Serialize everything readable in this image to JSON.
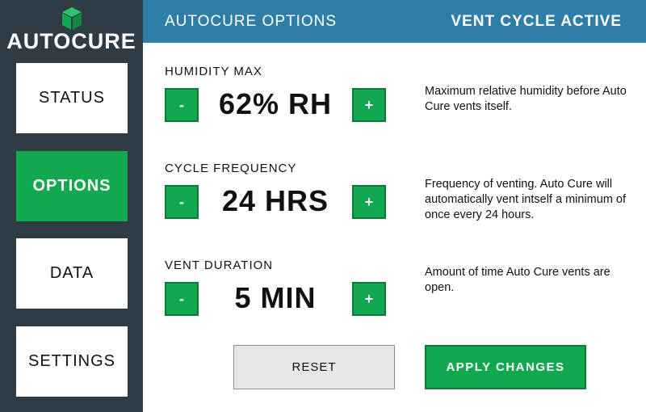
{
  "brand": {
    "logo_text": "AUTOCURE",
    "logo_icon": "cube-icon"
  },
  "nav": {
    "items": [
      {
        "label": "STATUS",
        "active": false
      },
      {
        "label": "OPTIONS",
        "active": true
      },
      {
        "label": "DATA",
        "active": false
      },
      {
        "label": "SETTINGS",
        "active": false
      }
    ]
  },
  "header": {
    "title": "AUTOCURE OPTIONS",
    "status": "VENT CYCLE ACTIVE"
  },
  "settings": [
    {
      "label": "HUMIDITY MAX",
      "value": "62% RH",
      "minus": "-",
      "plus": "+",
      "description": "Maximum relative humidity before Auto Cure vents itself."
    },
    {
      "label": "CYCLE FREQUENCY",
      "value": "24 HRS",
      "minus": "-",
      "plus": "+",
      "description": "Frequency of venting. Auto Cure will automatically vent intself a minimum of once every 24 hours."
    },
    {
      "label": "VENT DURATION",
      "value": "5 MIN",
      "minus": "-",
      "plus": "+",
      "description": "Amount of time Auto Cure vents are open."
    }
  ],
  "actions": {
    "reset_label": "RESET",
    "apply_label": "APPLY CHANGES"
  },
  "colors": {
    "sidebar_bg": "#2f3b45",
    "header_bg": "#2e7ea7",
    "accent_green": "#11a84f",
    "button_grey": "#e6e6e6"
  }
}
